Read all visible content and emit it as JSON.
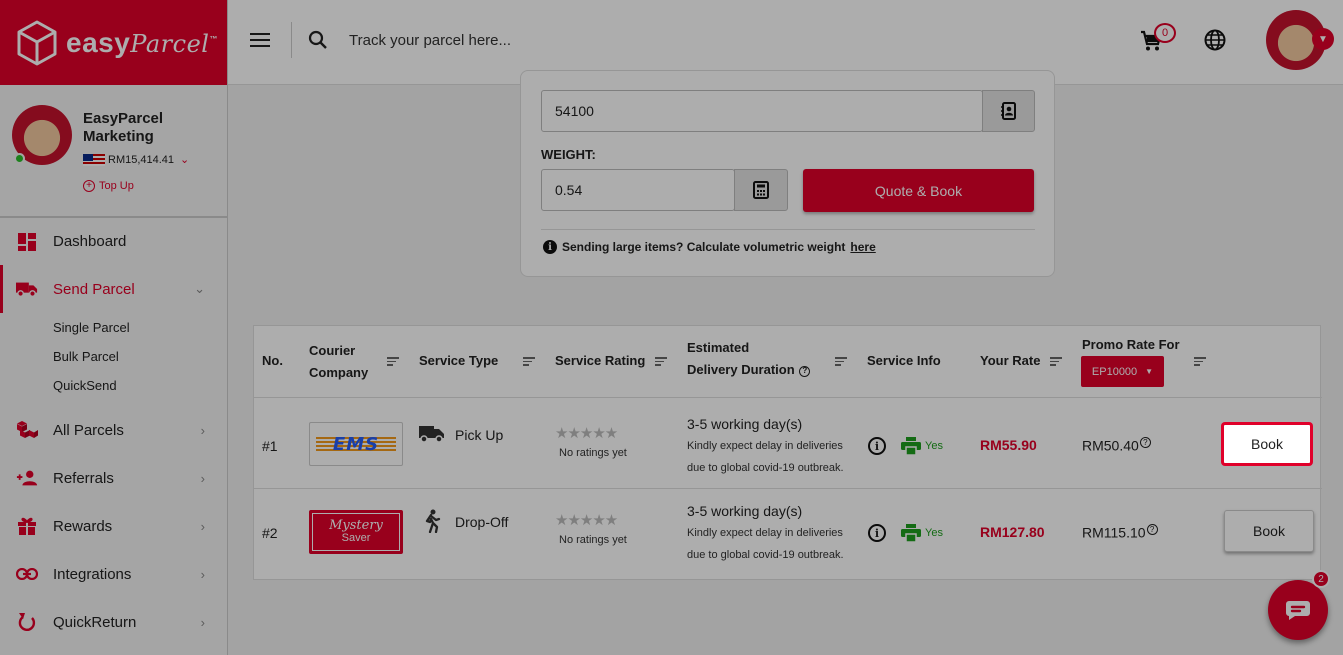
{
  "brand": {
    "name_bold": "easy",
    "name_script": "Parcel",
    "tm": "™"
  },
  "header": {
    "search_placeholder": "Track your parcel here...",
    "cart_count": "0"
  },
  "profile": {
    "name": "EasyParcel Marketing",
    "balance": "RM15,414.41",
    "topup_label": "Top Up"
  },
  "sidebar": {
    "items": [
      {
        "label": "Dashboard",
        "icon": "dashboard-icon"
      },
      {
        "label": "Send Parcel",
        "icon": "truck-icon",
        "sub": [
          "Single Parcel",
          "Bulk Parcel",
          "QuickSend"
        ]
      },
      {
        "label": "All Parcels",
        "icon": "boxes-icon"
      },
      {
        "label": "Referrals",
        "icon": "users-icon"
      },
      {
        "label": "Rewards",
        "icon": "gift-icon"
      },
      {
        "label": "Integrations",
        "icon": "link-icon"
      },
      {
        "label": "QuickReturn",
        "icon": "return-icon"
      }
    ]
  },
  "form": {
    "postcode_value": "54100",
    "weight_label": "WEIGHT:",
    "weight_value": "0.54",
    "quote_button": "Quote & Book",
    "vol_note": "Sending large items? Calculate volumetric weight",
    "vol_link": "here"
  },
  "table": {
    "headers": {
      "no": "No.",
      "courier_l1": "Courier",
      "courier_l2": "Company",
      "service_type": "Service Type",
      "rating": "Service Rating",
      "est_l1": "Estimated",
      "est_l2": "Delivery Duration",
      "service_info": "Service Info",
      "your_rate": "Your Rate",
      "promo": "Promo Rate For",
      "promo_code": "EP10000"
    },
    "rows": [
      {
        "no": "#1",
        "courier_logo_text": "EMS",
        "service_type": "Pick Up",
        "stars": "★★★★★",
        "rating_text": "No ratings yet",
        "duration": "3-5 working day(s)",
        "note_l1": "Kindly expect delay in deliveries",
        "note_l2": "due to global covid-19 outbreak.",
        "print": "Yes",
        "rate": "RM55.90",
        "promo": "RM50.40",
        "book": "Book"
      },
      {
        "no": "#2",
        "courier_logo_l1": "Mystery",
        "courier_logo_l2": "Saver",
        "service_type": "Drop-Off",
        "stars": "★★★★★",
        "rating_text": "No ratings yet",
        "duration": "3-5 working day(s)",
        "note_l1": "Kindly expect delay in deliveries",
        "note_l2": "due to global covid-19 outbreak.",
        "print": "Yes",
        "rate": "RM127.80",
        "promo": "RM115.10",
        "book": "Book"
      }
    ]
  },
  "chat": {
    "badge": "2"
  },
  "colors": {
    "brand_red": "#e0002a",
    "green": "#1e9e1e"
  }
}
